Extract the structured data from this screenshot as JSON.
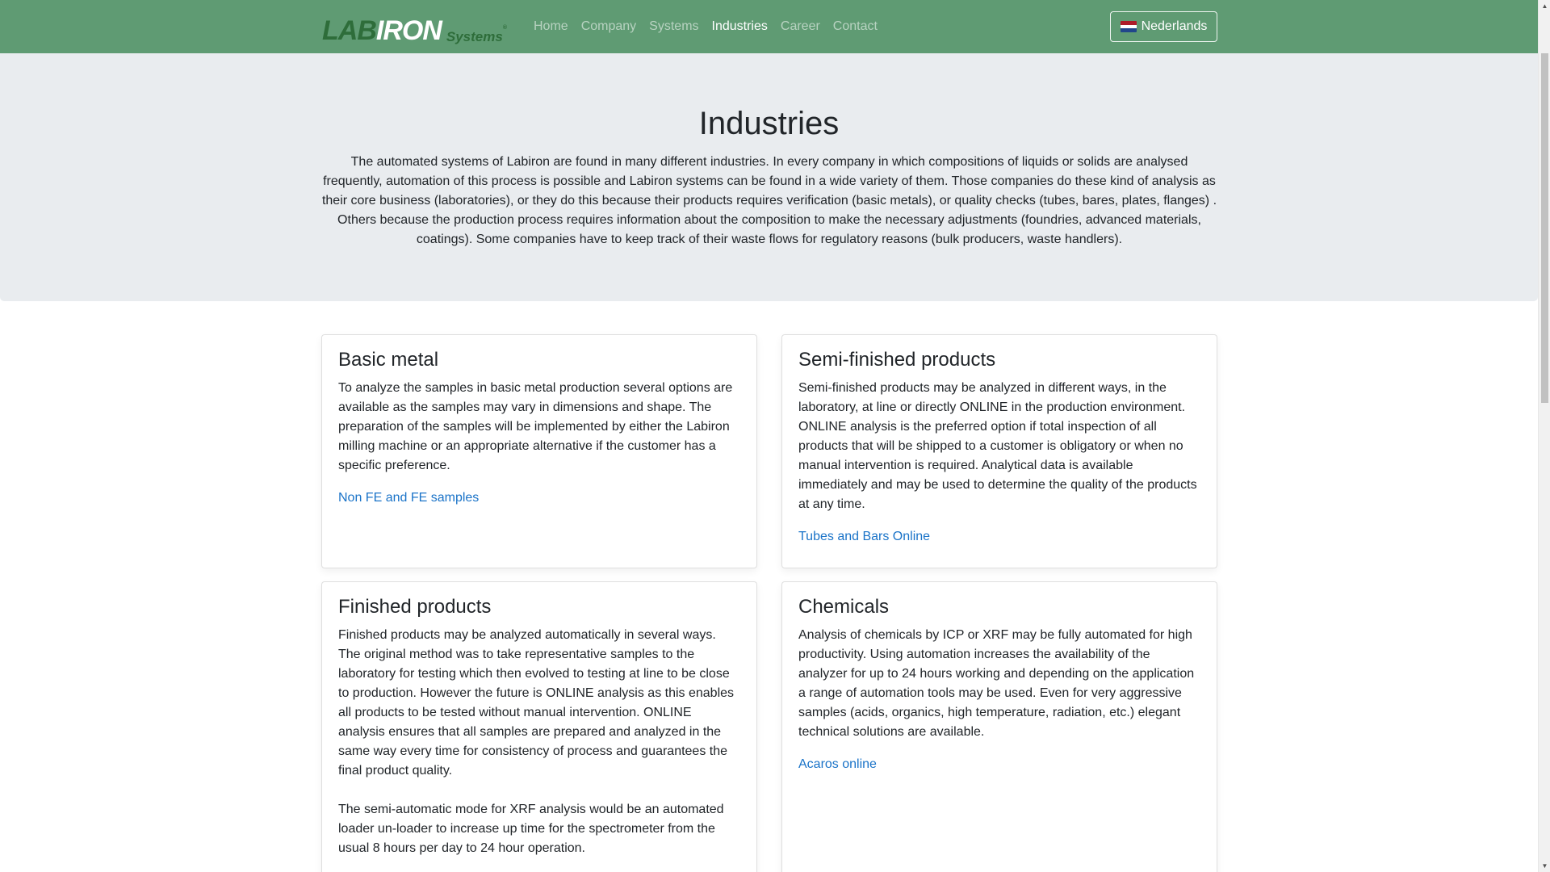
{
  "navbar": {
    "logo": {
      "lab": "LAB",
      "iron": "IRON",
      "systems": "Systems",
      "reg": "®"
    },
    "links": [
      {
        "label": "Home",
        "active": false
      },
      {
        "label": "Company",
        "active": false
      },
      {
        "label": "Systems",
        "active": false
      },
      {
        "label": "Industries",
        "active": true
      },
      {
        "label": "Career",
        "active": false
      },
      {
        "label": "Contact",
        "active": false
      }
    ],
    "language_button": "Nederlands",
    "language_flag_icon": "netherlands-flag-icon"
  },
  "hero": {
    "title": "Industries",
    "text": "The automated systems of Labiron are found in many different industries. In every company in which compositions of liquids or solids are analysed frequently, automation of this process is possible and Labiron systems can be found in a wide variety of them. Those companies do these kind of analysis as their core business (laboratories), or they do this because their products requires verification (basic metals), or quality checks (tubes, bares, plates, flanges) . Others because the production process requires information about the composition to make the necessary adjustments (foundries, advanced materials, coatings). Some companies have to keep track of their waste flows for regulatory reasons (bulk producers, waste handlers)."
  },
  "cards": [
    {
      "title": "Basic metal",
      "paragraphs": [
        "To analyze the samples in basic metal production several options are available as the samples may vary in dimensions and shape. The preparation of the samples will be implemented by either the Labiron milling machine or an appropriate alternative if the customer has a specific preference."
      ],
      "link": "Non FE and FE samples"
    },
    {
      "title": "Semi-finished products",
      "paragraphs": [
        "Semi-finished products may be analyzed in different ways, in the laboratory, at line or directly ONLINE in the production environment. ONLINE analysis is the preferred option if total inspection of all products that will be shipped to a customer is obligatory or when no manual intervention is required. Analytical data is available immediately and may be used to determine the quality of the products at any time."
      ],
      "link": "Tubes and Bars Online"
    },
    {
      "title": "Finished products",
      "paragraphs": [
        "Finished products may be analyzed automatically in several ways. The original method was to take representative samples to the laboratory for testing which then evolved to testing at line to be close to production. However the future is ONLINE analysis as this enables all products to be tested without manual intervention. ONLINE analysis ensures that all samples are prepared and analyzed in the same way every time for consistency of process and guarantees the final product quality.",
        "The semi-automatic mode for XRF analysis would be an automated loader un-loader to increase up time for the spectrometer from the usual 8 hours per day to 24 hour operation."
      ],
      "link": ""
    },
    {
      "title": "Chemicals",
      "paragraphs": [
        "Analysis of chemicals by ICP or XRF may be fully automated for high productivity. Using automation increases the availability of the analyzer for up to 24 hours working and depending on the application a range of automation tools may be used. Even for very aggressive samples (acids, organics, high temperature, radiation, etc.) elegant technical solutions are available."
      ],
      "link": "Acaros online"
    }
  ],
  "colors": {
    "navbar_bg": "#5f9b73",
    "logo_green": "#2e6d3a",
    "hero_bg": "#e9ecef",
    "link": "#1a73c8"
  }
}
